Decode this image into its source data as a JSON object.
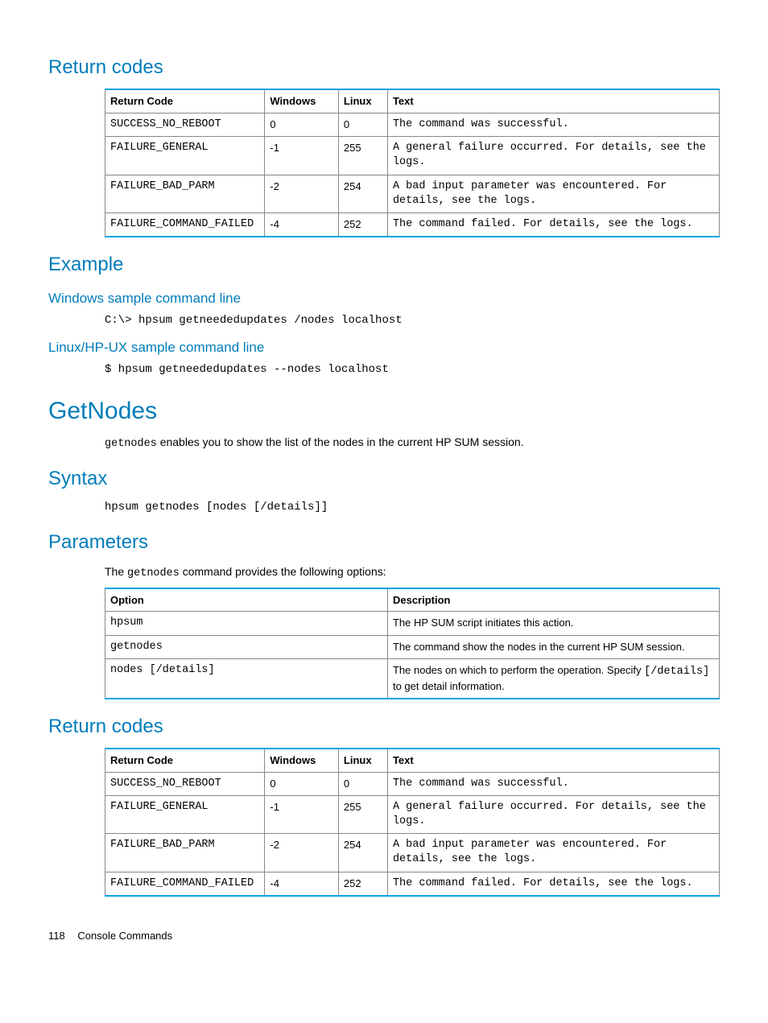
{
  "headings": {
    "return_codes1": "Return codes",
    "example": "Example",
    "win_sample": "Windows sample command line",
    "linux_sample": "Linux/HP-UX sample command line",
    "getnodes": "GetNodes",
    "syntax": "Syntax",
    "parameters": "Parameters",
    "return_codes2": "Return codes"
  },
  "table_headers": {
    "return_code": "Return Code",
    "windows": "Windows",
    "linux": "Linux",
    "text": "Text",
    "option": "Option",
    "description": "Description"
  },
  "return_table1": [
    {
      "code": "SUCCESS_NO_REBOOT",
      "win": "0",
      "lin": "0",
      "text": "The command was successful."
    },
    {
      "code": "FAILURE_GENERAL",
      "win": "-1",
      "lin": "255",
      "text": "A general failure occurred. For details, see the logs."
    },
    {
      "code": "FAILURE_BAD_PARM",
      "win": "-2",
      "lin": "254",
      "text": "A bad input parameter was encountered. For details, see the logs."
    },
    {
      "code": "FAILURE_COMMAND_FAILED",
      "win": "-4",
      "lin": "252",
      "text": "The command failed. For details, see the logs."
    }
  ],
  "example_win_cmd": "C:\\> hpsum getneededupdates /nodes localhost",
  "example_linux_cmd": "$ hpsum getneededupdates --nodes localhost",
  "getnodes_desc_pre": "getnodes",
  "getnodes_desc_post": " enables you to show the list of the nodes in the current HP SUM session.",
  "syntax_cmd": "hpsum getnodes [nodes [/details]]",
  "params_desc_pre": "The ",
  "params_desc_code": "getnodes",
  "params_desc_post": " command provides the following options:",
  "param_table": [
    {
      "opt": "hpsum",
      "desc": "The HP SUM script initiates this action."
    },
    {
      "opt": "getnodes",
      "desc": "The command show the nodes in the current HP SUM session."
    },
    {
      "opt": "nodes [/details]",
      "desc_pre": "The nodes on which to perform the operation. Specify ",
      "desc_code": "[/details]",
      "desc_post": " to get detail information."
    }
  ],
  "return_table2": [
    {
      "code": "SUCCESS_NO_REBOOT",
      "win": "0",
      "lin": "0",
      "text": "The command was successful."
    },
    {
      "code": "FAILURE_GENERAL",
      "win": "-1",
      "lin": "255",
      "text": "A general failure occurred. For details, see the logs."
    },
    {
      "code": "FAILURE_BAD_PARM",
      "win": "-2",
      "lin": "254",
      "text": "A bad input parameter was encountered. For details, see the logs."
    },
    {
      "code": "FAILURE_COMMAND_FAILED",
      "win": "-4",
      "lin": "252",
      "text": "The command failed. For details, see the logs."
    }
  ],
  "footer": {
    "page": "118",
    "title": "Console Commands"
  }
}
